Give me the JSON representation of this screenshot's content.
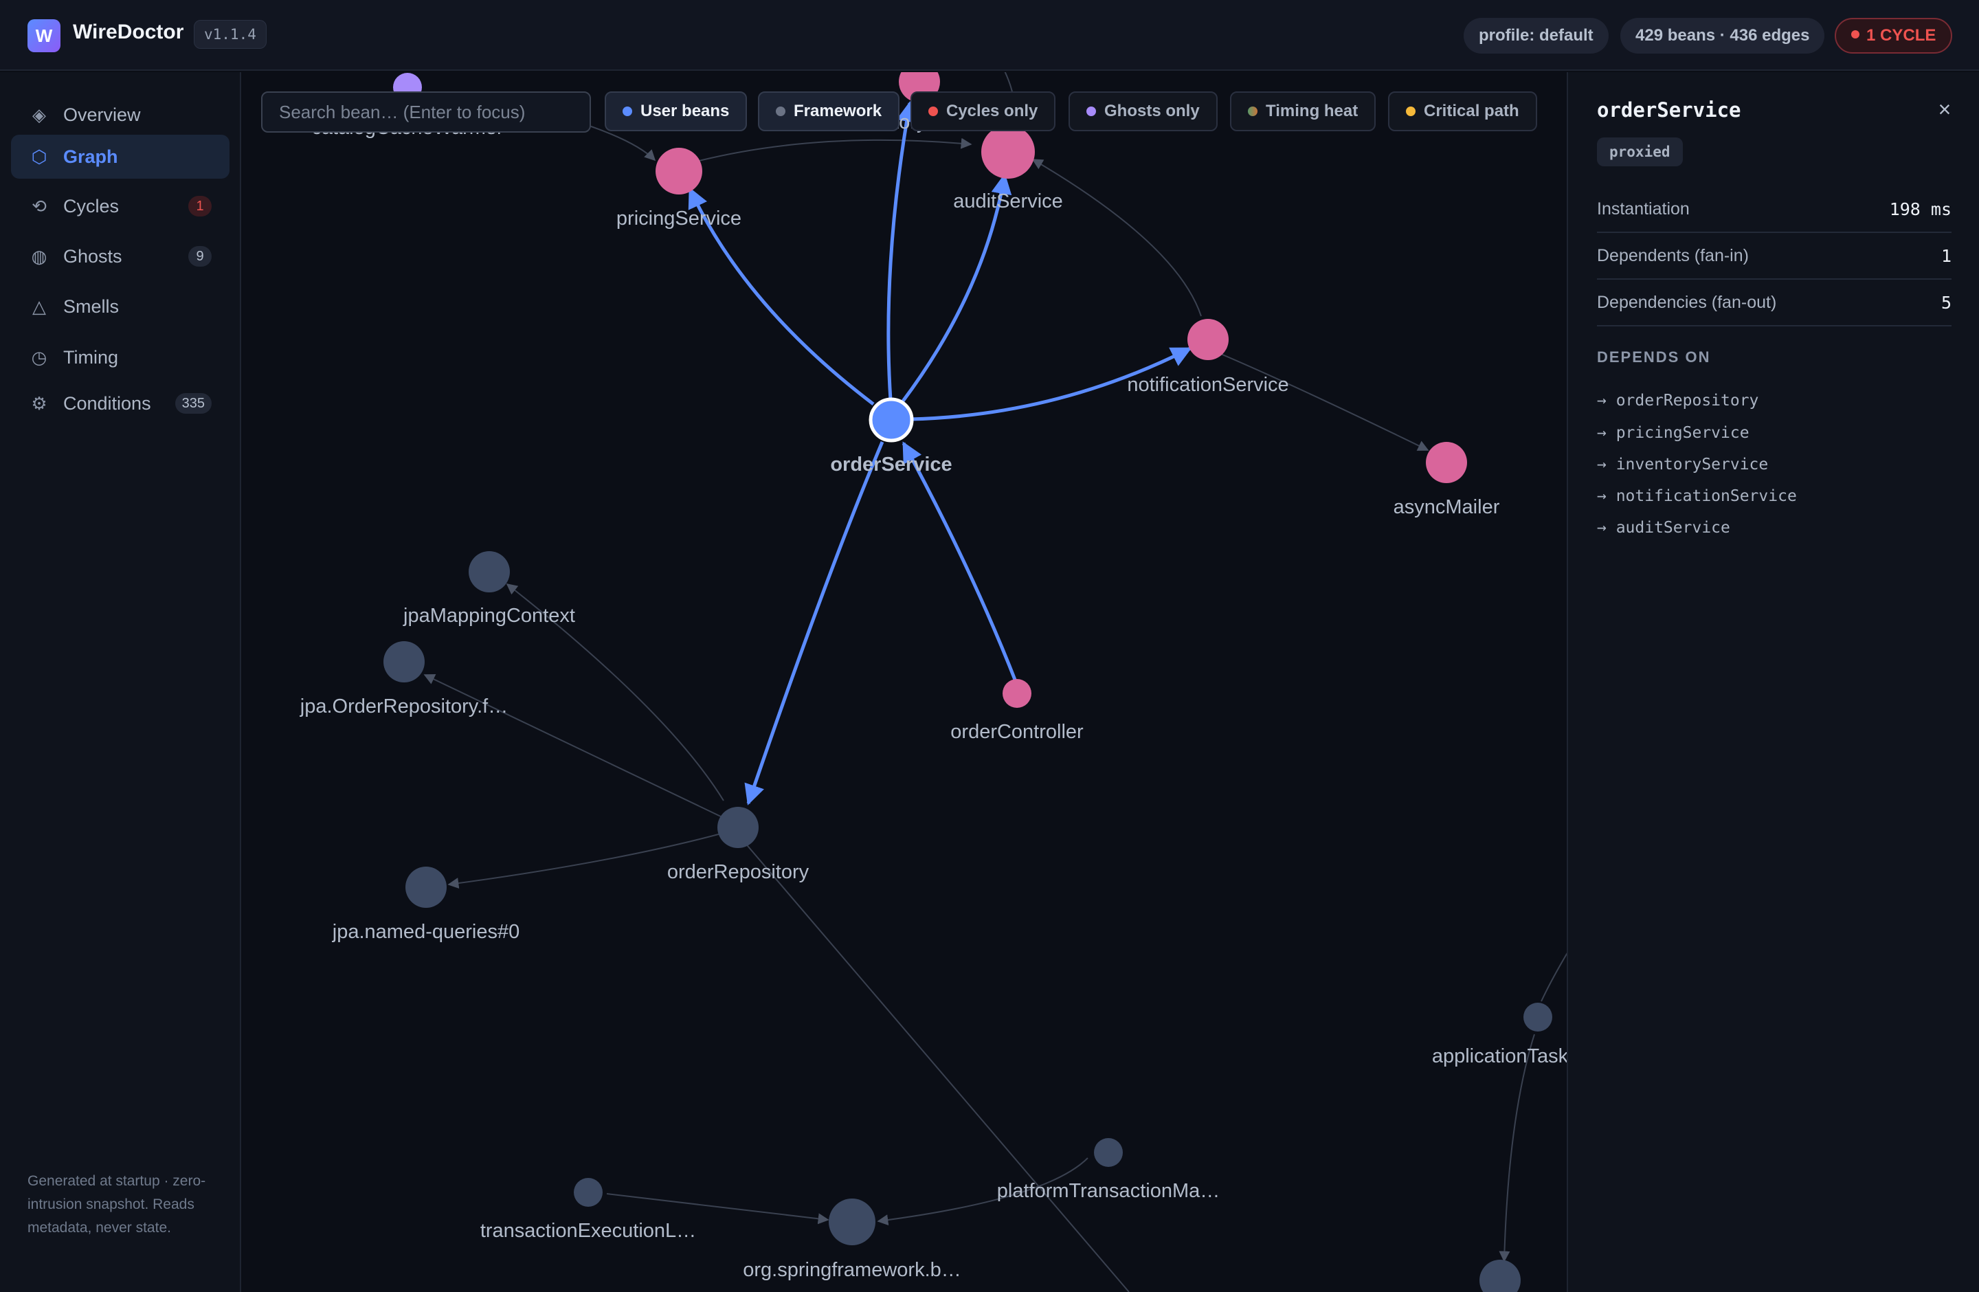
{
  "app": {
    "logo_letter": "W",
    "name": "WireDoctor",
    "version": "v1.1.4"
  },
  "header": {
    "profile": "profile: default",
    "stats": "429 beans · 436 edges",
    "cycle_badge": "1 CYCLE"
  },
  "sidebar": {
    "items": [
      {
        "label": "Overview",
        "icon": "diamond-icon",
        "glyph": "◈",
        "badge": ""
      },
      {
        "label": "Graph",
        "icon": "hexagon-icon",
        "glyph": "⬡",
        "badge": "",
        "active": true
      },
      {
        "label": "Cycles",
        "icon": "cycle-arrow-icon",
        "glyph": "⟲",
        "badge": "1"
      },
      {
        "label": "Ghosts",
        "icon": "ghost-circle-icon",
        "glyph": "◍",
        "badge": "9"
      },
      {
        "label": "Smells",
        "icon": "triangle-warning-icon",
        "glyph": "△",
        "badge": ""
      },
      {
        "label": "Timing",
        "icon": "clock-icon",
        "glyph": "◷",
        "badge": ""
      },
      {
        "label": "Conditions",
        "icon": "gear-icon",
        "glyph": "⚙",
        "badge": "335"
      }
    ],
    "footer": "Generated at startup · zero-intrusion snapshot. Reads metadata, never state."
  },
  "toolbar": {
    "search_placeholder": "Search bean… (Enter to focus)",
    "chips": [
      {
        "label": "User beans",
        "color": "#5b8cff",
        "active": true
      },
      {
        "label": "Framework",
        "color": "#6b7385",
        "active": true
      },
      {
        "label": "Cycles only",
        "color": "#ef5350",
        "active": false
      },
      {
        "label": "Ghosts only",
        "color": "#a78bfa",
        "active": false
      },
      {
        "label": "Timing heat",
        "color": "#7a9a5a",
        "active": false
      },
      {
        "label": "Critical path",
        "color": "#f5b93a",
        "active": false
      }
    ]
  },
  "graph": {
    "colors": {
      "selected": "#5b8cff",
      "user": "#d9659b",
      "framework": "#3d4a63",
      "ghost": "#a78bfa",
      "edge": "#3a4150",
      "highlight": "#5b8cff"
    },
    "nodes": [
      {
        "id": "catalogCacheWarmer",
        "label": "catalogCacheWarmer",
        "kind": "ghost"
      },
      {
        "id": "inventoryService",
        "label": "inventoryService",
        "kind": "user"
      },
      {
        "id": "pricingService",
        "label": "pricingService",
        "kind": "user"
      },
      {
        "id": "auditService",
        "label": "auditService",
        "kind": "user"
      },
      {
        "id": "notificationService",
        "label": "notificationService",
        "kind": "user"
      },
      {
        "id": "orderService",
        "label": "orderService",
        "kind": "selected"
      },
      {
        "id": "asyncMailer",
        "label": "asyncMailer",
        "kind": "user"
      },
      {
        "id": "jpaMappingContext",
        "label": "jpaMappingContext",
        "kind": "framework"
      },
      {
        "id": "jpaOrderRepositoryF",
        "label": "jpa.OrderRepository.f…",
        "kind": "framework"
      },
      {
        "id": "orderController",
        "label": "orderController",
        "kind": "user"
      },
      {
        "id": "orderRepository",
        "label": "orderRepository",
        "kind": "framework"
      },
      {
        "id": "jpaNamedQueries",
        "label": "jpa.named-queries#0",
        "kind": "framework"
      },
      {
        "id": "applicationTask",
        "label": "applicationTask",
        "kind": "framework"
      },
      {
        "id": "platformTransactionMa",
        "label": "platformTransactionMa…",
        "kind": "framework"
      },
      {
        "id": "transactionExecutionL",
        "label": "transactionExecutionL…",
        "kind": "framework"
      },
      {
        "id": "orgSpringframeworkB",
        "label": "org.springframework.b…",
        "kind": "framework"
      },
      {
        "id": "unlabeledBottom",
        "label": "",
        "kind": "framework"
      }
    ]
  },
  "panel": {
    "title": "orderService",
    "tag": "proxied",
    "rows": [
      {
        "label": "Instantiation",
        "value": "198 ms"
      },
      {
        "label": "Dependents (fan-in)",
        "value": "1"
      },
      {
        "label": "Dependencies (fan-out)",
        "value": "5"
      }
    ],
    "section": "DEPENDS ON",
    "depends_on": [
      "→ orderRepository",
      "→ pricingService",
      "→ inventoryService",
      "→ notificationService",
      "→ auditService"
    ],
    "close": "×"
  }
}
